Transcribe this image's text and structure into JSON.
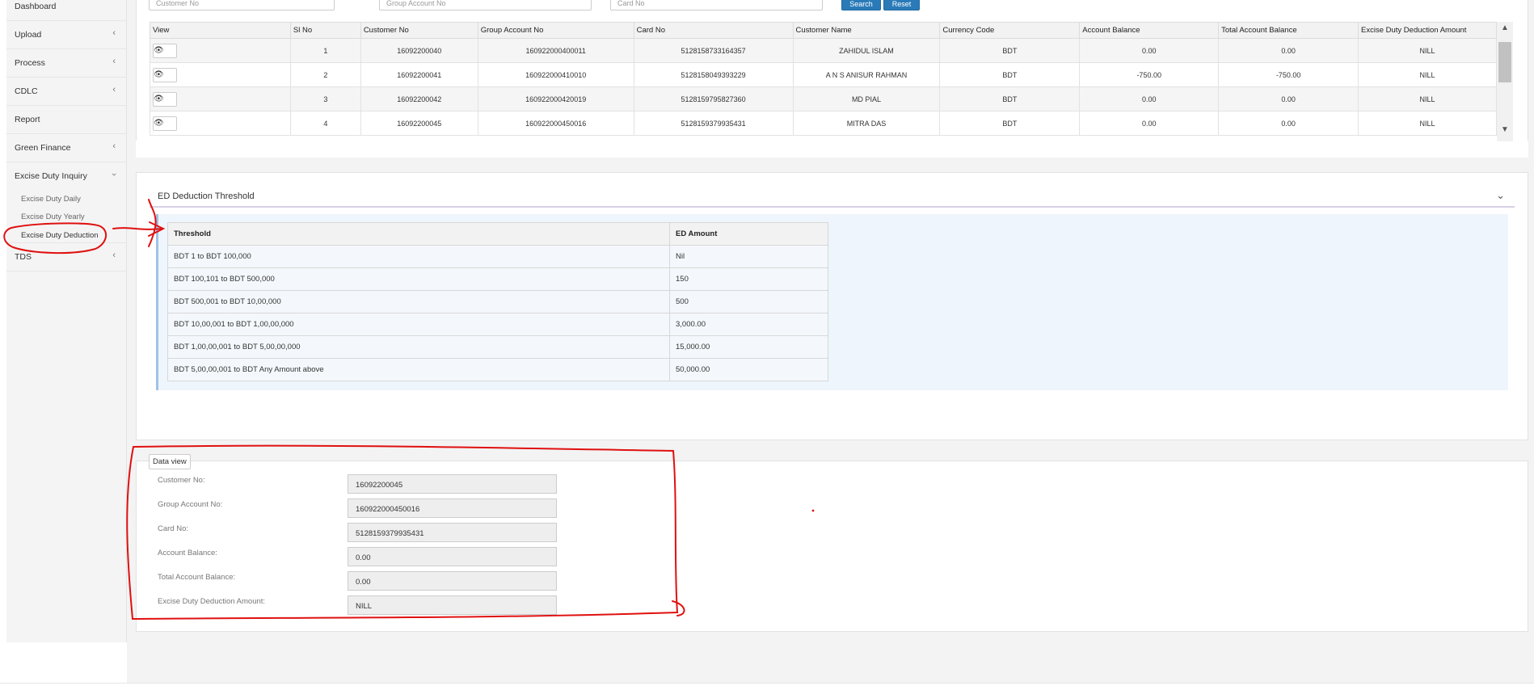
{
  "sidebar": {
    "items": [
      {
        "label": "Dashboard",
        "chevron": ""
      },
      {
        "label": "Upload",
        "chevron": "‹"
      },
      {
        "label": "Process",
        "chevron": "‹"
      },
      {
        "label": "CDLC",
        "chevron": "‹"
      },
      {
        "label": "Report",
        "chevron": ""
      },
      {
        "label": "Green Finance",
        "chevron": "‹"
      },
      {
        "label": "Excise Duty Inquiry",
        "chevron": "›"
      },
      {
        "label": "TDS",
        "chevron": "‹"
      }
    ],
    "sub_items": [
      "Excise Duty Daily",
      "Excise Duty Yearly",
      "Excise Duty Deduction"
    ]
  },
  "filters": {
    "customer_no_placeholder": "Customer No",
    "group_account_placeholder": "Group Account No",
    "card_no_placeholder": "Card No",
    "search_label": "Search",
    "reset_label": "Reset"
  },
  "grid": {
    "columns": [
      "View",
      "Sl No",
      "Customer No",
      "Group Account No",
      "Card No",
      "Customer Name",
      "Currency Code",
      "Account Balance",
      "Total Account Balance",
      "Excise Duty Deduction Amount"
    ],
    "rows": [
      {
        "sl": "1",
        "customer_no": "16092200040",
        "group_account": "160922000400011",
        "card_no": "5128158733164357",
        "name": "ZAHIDUL ISLAM",
        "currency": "BDT",
        "balance": "0.00",
        "total_balance": "0.00",
        "deduction": "NILL"
      },
      {
        "sl": "2",
        "customer_no": "16092200041",
        "group_account": "160922000410010",
        "card_no": "5128158049393229",
        "name": "A N S ANISUR RAHMAN",
        "currency": "BDT",
        "balance": "-750.00",
        "total_balance": "-750.00",
        "deduction": "NILL"
      },
      {
        "sl": "3",
        "customer_no": "16092200042",
        "group_account": "160922000420019",
        "card_no": "5128159795827360",
        "name": "MD PIAL",
        "currency": "BDT",
        "balance": "0.00",
        "total_balance": "0.00",
        "deduction": "NILL"
      },
      {
        "sl": "4",
        "customer_no": "16092200045",
        "group_account": "160922000450016",
        "card_no": "5128159379935431",
        "name": "MITRA DAS",
        "currency": "BDT",
        "balance": "0.00",
        "total_balance": "0.00",
        "deduction": "NILL"
      }
    ],
    "scroll_up": "▲",
    "scroll_down": "▼"
  },
  "threshold": {
    "title": "ED Deduction Threshold",
    "collapse_icon": "⌄",
    "headers": [
      "Threshold",
      "ED Amount"
    ],
    "rows": [
      [
        "BDT 1 to BDT 100,000",
        "Nil"
      ],
      [
        "BDT 100,101 to BDT 500,000",
        "150"
      ],
      [
        "BDT 500,001 to BDT 10,00,000",
        "500"
      ],
      [
        "BDT 10,00,001 to BDT 1,00,00,000",
        "3,000.00"
      ],
      [
        "BDT 1,00,00,001 to BDT 5,00,00,000",
        "15,000.00"
      ],
      [
        "BDT 5,00,00,001 to BDT Any Amount above",
        "50,000.00"
      ]
    ]
  },
  "data_view": {
    "legend": "Data view",
    "fields": [
      {
        "label": "Customer No:",
        "value": "16092200045"
      },
      {
        "label": "Group Account No:",
        "value": "160922000450016"
      },
      {
        "label": "Card No:",
        "value": "5128159379935431"
      },
      {
        "label": "Account Balance:",
        "value": "0.00"
      },
      {
        "label": "Total Account Balance:",
        "value": "0.00"
      },
      {
        "label": "Excise Duty Deduction Amount:",
        "value": "NILL"
      }
    ]
  },
  "colors": {
    "accent": "#2a7ab8",
    "annotation": "#e01010"
  },
  "icons": {
    "view": "eye-icon"
  }
}
